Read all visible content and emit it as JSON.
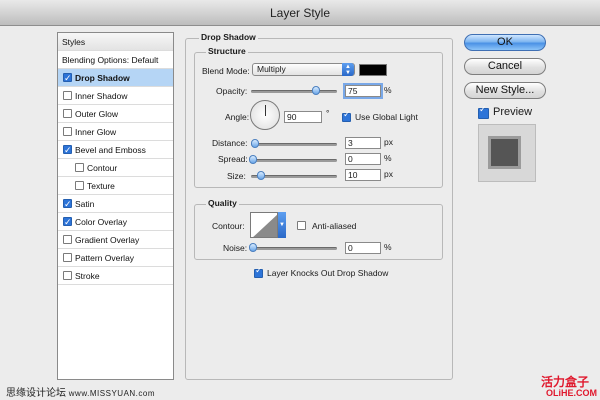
{
  "window": {
    "title": "Layer Style"
  },
  "styles_list": {
    "header": "Styles",
    "items": [
      {
        "label": "Blending Options: Default",
        "checkbox": false,
        "checked": false,
        "selected": false,
        "indent": false
      },
      {
        "label": "Drop Shadow",
        "checkbox": true,
        "checked": true,
        "selected": true,
        "indent": false
      },
      {
        "label": "Inner Shadow",
        "checkbox": true,
        "checked": false,
        "selected": false,
        "indent": false
      },
      {
        "label": "Outer Glow",
        "checkbox": true,
        "checked": false,
        "selected": false,
        "indent": false
      },
      {
        "label": "Inner Glow",
        "checkbox": true,
        "checked": false,
        "selected": false,
        "indent": false
      },
      {
        "label": "Bevel and Emboss",
        "checkbox": true,
        "checked": true,
        "selected": false,
        "indent": false
      },
      {
        "label": "Contour",
        "checkbox": true,
        "checked": false,
        "selected": false,
        "indent": true
      },
      {
        "label": "Texture",
        "checkbox": true,
        "checked": false,
        "selected": false,
        "indent": true
      },
      {
        "label": "Satin",
        "checkbox": true,
        "checked": true,
        "selected": false,
        "indent": false
      },
      {
        "label": "Color Overlay",
        "checkbox": true,
        "checked": true,
        "selected": false,
        "indent": false
      },
      {
        "label": "Gradient Overlay",
        "checkbox": true,
        "checked": false,
        "selected": false,
        "indent": false
      },
      {
        "label": "Pattern Overlay",
        "checkbox": true,
        "checked": false,
        "selected": false,
        "indent": false
      },
      {
        "label": "Stroke",
        "checkbox": true,
        "checked": false,
        "selected": false,
        "indent": false
      }
    ]
  },
  "drop_shadow": {
    "title": "Drop Shadow",
    "structure": {
      "title": "Structure",
      "blend_mode_label": "Blend Mode:",
      "blend_mode_value": "Multiply",
      "shadow_color": "#000000",
      "opacity_label": "Opacity:",
      "opacity_value": "75",
      "opacity_unit": "%",
      "opacity_level": 0.75,
      "angle_label": "Angle:",
      "angle_value": "90",
      "angle_unit": "°",
      "use_global_light_label": "Use Global Light",
      "use_global_light": true,
      "distance_label": "Distance:",
      "distance_value": "3",
      "distance_unit": "px",
      "spread_label": "Spread:",
      "spread_value": "0",
      "spread_unit": "%",
      "size_label": "Size:",
      "size_value": "10",
      "size_unit": "px"
    },
    "quality": {
      "title": "Quality",
      "contour_label": "Contour:",
      "anti_aliased_label": "Anti-aliased",
      "anti_aliased": false,
      "noise_label": "Noise:",
      "noise_value": "0",
      "noise_unit": "%"
    },
    "knockout_label": "Layer Knocks Out Drop Shadow",
    "knockout": true
  },
  "buttons": {
    "ok": "OK",
    "cancel": "Cancel",
    "new_style": "New Style...",
    "preview_label": "Preview",
    "preview_checked": true
  },
  "watermarks": {
    "left": "思缘设计论坛",
    "left_url": "www.MISSYUAN.com",
    "right_top": "活力盒子",
    "right_bottom": "OLiHE.COM"
  },
  "colors": {
    "accent": "#2d74d8",
    "selected_row": "#b5d5f5",
    "watermark_red": "#e0182d"
  }
}
